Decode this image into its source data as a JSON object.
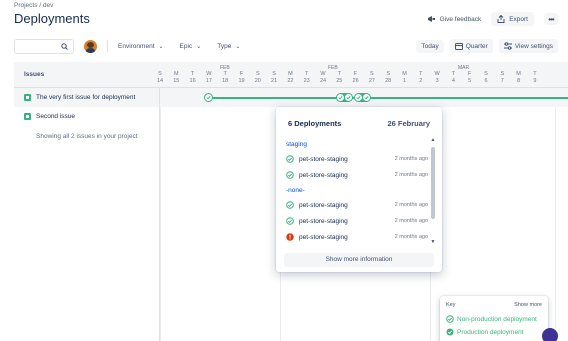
{
  "breadcrumb": "Projects  /  dev",
  "page_title": "Deployments",
  "top_actions": {
    "feedback": "Give feedback",
    "export": "Export",
    "more": "•••"
  },
  "toolbar": {
    "search_placeholder": "",
    "filters": [
      "Environment",
      "Epic",
      "Type"
    ],
    "today": "Today",
    "quarter": "Quarter",
    "view_settings": "View settings"
  },
  "issues": {
    "header": "Issues",
    "rows": [
      "The very first issue for deployment",
      "Second issue"
    ],
    "showing": "Showing all 2 issues in your project"
  },
  "timeline": {
    "months": [
      "FEB",
      "FEB",
      "MAR"
    ],
    "days": [
      {
        "l": "S",
        "n": "14"
      },
      {
        "l": "M",
        "n": "15"
      },
      {
        "l": "T",
        "n": "16"
      },
      {
        "l": "W",
        "n": "17"
      },
      {
        "l": "T",
        "n": "18"
      },
      {
        "l": "F",
        "n": "19"
      },
      {
        "l": "S",
        "n": "20"
      },
      {
        "l": "S",
        "n": "21"
      },
      {
        "l": "M",
        "n": "22"
      },
      {
        "l": "T",
        "n": "23"
      },
      {
        "l": "W",
        "n": "24"
      },
      {
        "l": "T",
        "n": "25"
      },
      {
        "l": "F",
        "n": "26"
      },
      {
        "l": "S",
        "n": "27"
      },
      {
        "l": "S",
        "n": "28"
      },
      {
        "l": "M",
        "n": "1"
      },
      {
        "l": "T",
        "n": "2"
      },
      {
        "l": "W",
        "n": "3"
      },
      {
        "l": "T",
        "n": "4"
      },
      {
        "l": "F",
        "n": "5"
      },
      {
        "l": "S",
        "n": "6"
      },
      {
        "l": "S",
        "n": "7"
      },
      {
        "l": "M",
        "n": "8"
      },
      {
        "l": "T",
        "n": "9"
      }
    ]
  },
  "popup": {
    "count": "6 Deployments",
    "date": "26 February",
    "items": [
      {
        "type": "env",
        "label": "staging"
      },
      {
        "type": "dep",
        "name": "pet-store-staging",
        "ago": "2 months ago",
        "status": "success"
      },
      {
        "type": "dep",
        "name": "pet-store-staging",
        "ago": "2 months ago",
        "status": "success"
      },
      {
        "type": "env",
        "label": "-none-"
      },
      {
        "type": "dep",
        "name": "pet-store-staging",
        "ago": "2 months ago",
        "status": "success"
      },
      {
        "type": "dep",
        "name": "pet-store-staging",
        "ago": "2 months ago",
        "status": "success"
      },
      {
        "type": "dep",
        "name": "pet-store-staging",
        "ago": "2 months ago",
        "status": "failed"
      }
    ],
    "more_info": "Show more information"
  },
  "key": {
    "title": "Key",
    "show_more": "Show more",
    "items": [
      "Non-production deployment",
      "Production deployment"
    ]
  },
  "colors": {
    "success": "#36b37e",
    "failed": "#de350b",
    "link": "#0052cc"
  }
}
